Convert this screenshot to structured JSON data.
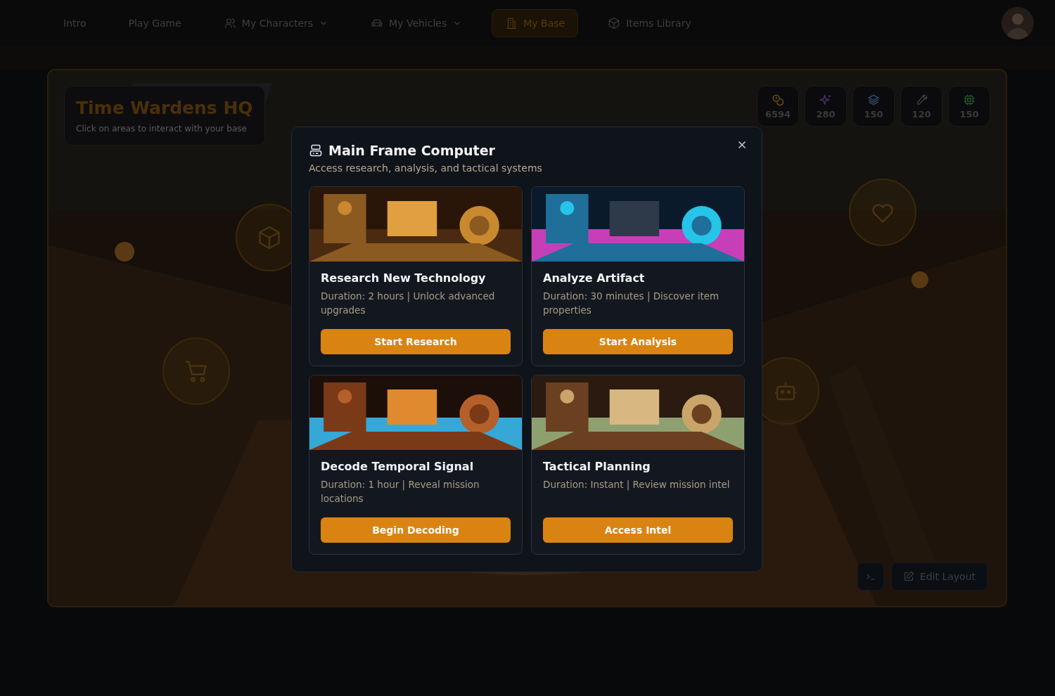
{
  "nav": {
    "items": [
      {
        "label": "Intro",
        "kind": "plain",
        "dropdown": false,
        "selected": false
      },
      {
        "label": "Play Game",
        "kind": "plain",
        "dropdown": false,
        "selected": false
      },
      {
        "label": "My Characters",
        "kind": "user",
        "dropdown": true,
        "selected": false
      },
      {
        "label": "My Vehicles",
        "kind": "car",
        "dropdown": true,
        "selected": false
      },
      {
        "label": "My Base",
        "kind": "building",
        "dropdown": false,
        "selected": true
      },
      {
        "label": "Items Library",
        "kind": "cube",
        "dropdown": false,
        "selected": false
      }
    ]
  },
  "base": {
    "title": "Time Wardens HQ",
    "subtitle": "Click on areas to interact with your base"
  },
  "resources": [
    {
      "kind": "coins",
      "value": "6594",
      "color": "#6e5010"
    },
    {
      "kind": "sparkle",
      "value": "280",
      "color": "#4e2f66"
    },
    {
      "kind": "layers",
      "value": "150",
      "color": "#2c4a6a"
    },
    {
      "kind": "wrench",
      "value": "120",
      "color": "#3c3c3e"
    },
    {
      "kind": "chip",
      "value": "150",
      "color": "#1f5428"
    }
  ],
  "edit_layout": {
    "label": "Edit Layout"
  },
  "modal": {
    "title": "Main Frame Computer",
    "subtitle": "Access research, analysis, and tactical systems",
    "cards": [
      {
        "title": "Research New Technology",
        "description": "Duration: 2 hours | Unlock advanced upgrades",
        "button": "Start Research"
      },
      {
        "title": "Analyze Artifact",
        "description": "Duration: 30 minutes | Discover item properties",
        "button": "Start Analysis"
      },
      {
        "title": "Decode Temporal Signal",
        "description": "Duration: 1 hour | Reveal mission locations",
        "button": "Begin Decoding"
      },
      {
        "title": "Tactical Planning",
        "description": "Duration: Instant | Review mission intel",
        "button": "Access Intel"
      }
    ]
  }
}
